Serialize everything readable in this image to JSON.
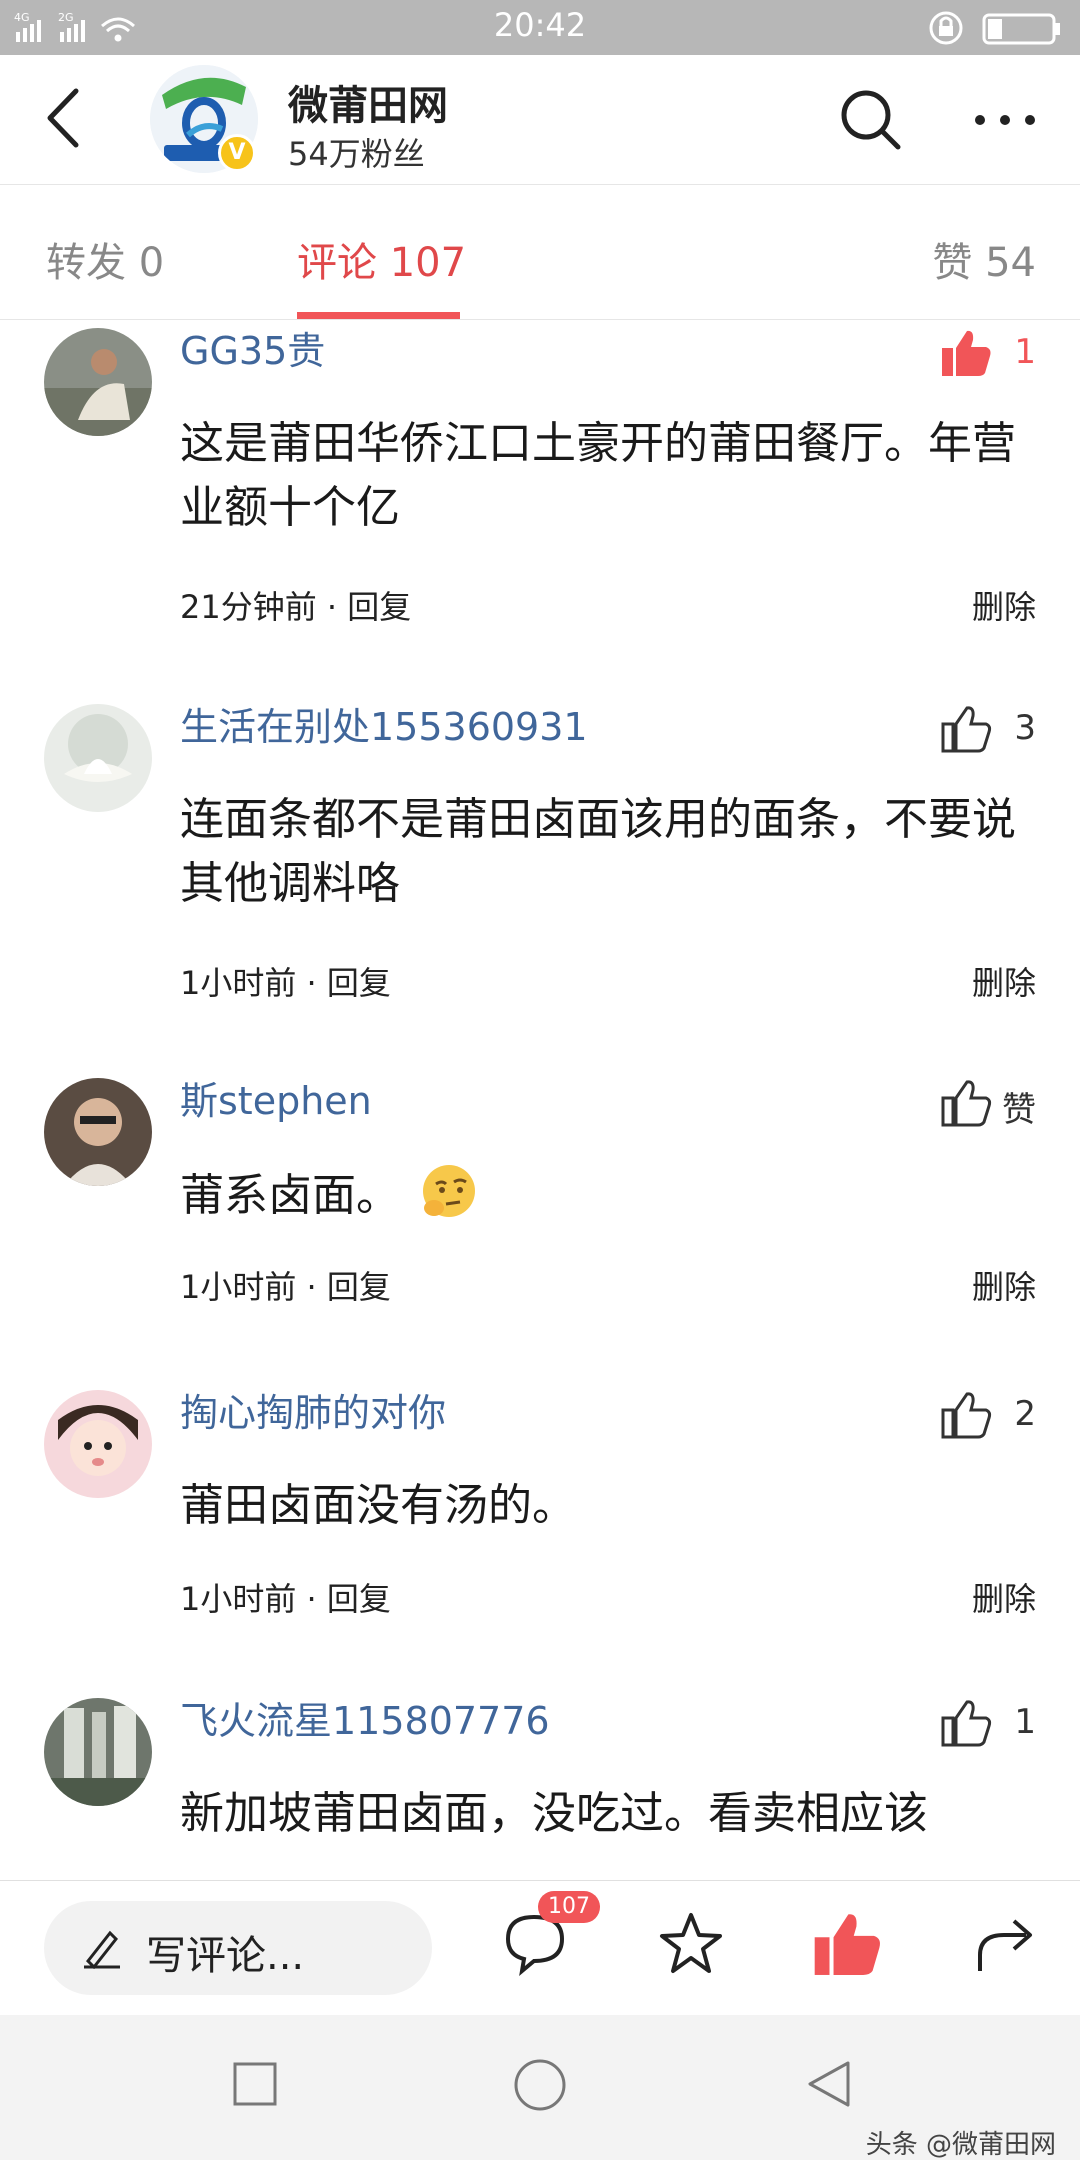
{
  "status_bar": {
    "time": "20:42"
  },
  "header": {
    "back_icon": "back-arrow-icon",
    "account_name": "微莆田网",
    "followers": "54万粉丝",
    "verified_badge": "V",
    "search_icon": "search-icon",
    "more_icon": "more-dots-icon"
  },
  "tabs": [
    {
      "label": "转发 0"
    },
    {
      "label": "评论 107",
      "active": true
    },
    {
      "label": "赞 54"
    }
  ],
  "comments": [
    {
      "user": "GG35贵",
      "like_count": "1",
      "liked": true,
      "text": "这是莆田华侨江口土豪开的莆田餐厅。年营业额十个亿",
      "time": "21分钟前",
      "reply": "回复",
      "delete": "删除"
    },
    {
      "user": "生活在别处155360931",
      "like_count": "3",
      "liked": false,
      "text": "连面条都不是莆田卤面该用的面条，不要说其他调料咯",
      "time": "1小时前",
      "reply": "回复",
      "delete": "删除"
    },
    {
      "user": "斯stephen",
      "like_count": "赞",
      "liked": false,
      "text": "莆系卤面。",
      "emoji": "thinking-face-emoji",
      "time": "1小时前",
      "reply": "回复",
      "delete": "删除"
    },
    {
      "user": "掏心掏肺的对你",
      "like_count": "2",
      "liked": false,
      "text": "莆田卤面没有汤的。",
      "time": "1小时前",
      "reply": "回复",
      "delete": "删除"
    },
    {
      "user": "飞火流星115807776",
      "like_count": "1",
      "liked": false,
      "text": "新加坡莆田卤面，没吃过。看卖相应该",
      "time": "",
      "reply": "",
      "delete": ""
    }
  ],
  "action_bar": {
    "write_placeholder": "写评论...",
    "comment_badge": "107",
    "icons": [
      "pen-icon",
      "comment-icon",
      "star-icon",
      "thumb-up-filled-icon",
      "share-icon"
    ]
  },
  "watermark": "头条 @微莆田网",
  "colors": {
    "accent_red": "#f15558",
    "username_blue": "#40669a",
    "status_bar_gray": "#b7b7b7"
  }
}
